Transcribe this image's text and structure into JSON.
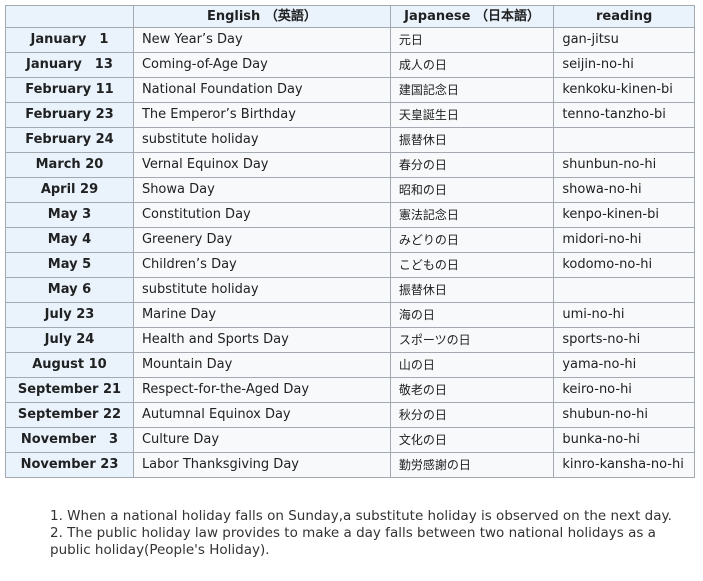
{
  "table": {
    "headers": {
      "date": "",
      "english": "English （英語）",
      "japanese": "Japanese （日本語）",
      "reading": "reading"
    },
    "rows": [
      {
        "date": "January　1",
        "english": "New Year’s Day",
        "japanese": "元日",
        "reading": "gan-jitsu"
      },
      {
        "date": "January　13",
        "english": "Coming-of-Age Day",
        "japanese": "成人の日",
        "reading": "seijin-no-hi"
      },
      {
        "date": "February 11",
        "english": "National Foundation Day",
        "japanese": "建国記念日",
        "reading": "kenkoku-kinen-bi"
      },
      {
        "date": "February 23",
        "english": "The Emperor’s Birthday",
        "japanese": "天皇誕生日",
        "reading": "tenno-tanzho-bi"
      },
      {
        "date": "February 24",
        "english": "substitute holiday",
        "japanese": "振替休日",
        "reading": ""
      },
      {
        "date": "March 20",
        "english": "Vernal Equinox Day",
        "japanese": "春分の日",
        "reading": "shunbun-no-hi"
      },
      {
        "date": "April 29",
        "english": "Showa Day",
        "japanese": "昭和の日",
        "reading": "showa-no-hi"
      },
      {
        "date": "May 3",
        "english": "Constitution Day",
        "japanese": "憲法記念日",
        "reading": "kenpo-kinen-bi"
      },
      {
        "date": "May 4",
        "english": "Greenery Day",
        "japanese": "みどりの日",
        "reading": "midori-no-hi"
      },
      {
        "date": "May 5",
        "english": "Children’s Day",
        "japanese": "こどもの日",
        "reading": "kodomo-no-hi"
      },
      {
        "date": "May 6",
        "english": "substitute holiday",
        "japanese": "振替休日",
        "reading": ""
      },
      {
        "date": "July 23",
        "english": "Marine Day",
        "japanese": "海の日",
        "reading": "umi-no-hi"
      },
      {
        "date": "July 24",
        "english": "Health and Sports Day",
        "japanese": "スポーツの日",
        "reading": "sports-no-hi"
      },
      {
        "date": "August 10",
        "english": "Mountain Day",
        "japanese": "山の日",
        "reading": "yama-no-hi"
      },
      {
        "date": "September 21",
        "english": "Respect-for-the-Aged Day",
        "japanese": "敬老の日",
        "reading": "keiro-no-hi"
      },
      {
        "date": "September 22",
        "english": "Autumnal Equinox Day",
        "japanese": "秋分の日",
        "reading": "shubun-no-hi"
      },
      {
        "date": "November　3",
        "english": "Culture Day",
        "japanese": "文化の日",
        "reading": "bunka-no-hi"
      },
      {
        "date": "November 23",
        "english": "Labor Thanksgiving Day",
        "japanese": "勤労感謝の日",
        "reading": "kinro-kansha-no-hi"
      }
    ]
  },
  "notes": [
    "1. When a national holiday falls on Sunday,a substitute holiday is observed on the next day.",
    "2. The public holiday law provides to make a day falls between two national holidays as a public holiday(People's Holiday)."
  ],
  "colors": {
    "header_bg": "#eaf3fb",
    "cell_bg": "#f8f9fa",
    "border": "#a2a9b1"
  }
}
